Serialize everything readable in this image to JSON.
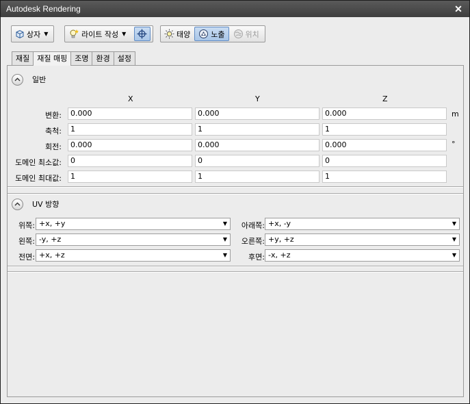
{
  "window": {
    "title": "Autodesk Rendering",
    "close_glyph": "✕"
  },
  "toolbar": {
    "box_label": "상자",
    "light_label": "라이트 작성",
    "sun_label": "태양",
    "exposure_label": "노출",
    "location_label": "위치"
  },
  "tabs": [
    {
      "label": "재질"
    },
    {
      "label": "재질 매핑"
    },
    {
      "label": "조명"
    },
    {
      "label": "환경"
    },
    {
      "label": "설정"
    }
  ],
  "general": {
    "title": "일반",
    "columns": [
      "X",
      "Y",
      "Z"
    ],
    "rows": [
      {
        "label": "변환:",
        "values": [
          "0.000",
          "0.000",
          "0.000"
        ],
        "unit": "m"
      },
      {
        "label": "축척:",
        "values": [
          "1",
          "1",
          "1"
        ],
        "unit": ""
      },
      {
        "label": "회전:",
        "values": [
          "0.000",
          "0.000",
          "0.000"
        ],
        "unit": "°"
      },
      {
        "label": "도메인 최소값:",
        "values": [
          "0",
          "0",
          "0"
        ],
        "unit": ""
      },
      {
        "label": "도메인 최대값:",
        "values": [
          "1",
          "1",
          "1"
        ],
        "unit": ""
      }
    ]
  },
  "uv": {
    "title": "UV 방향",
    "fields": [
      {
        "label": "위쪽:",
        "value": "+x, +y"
      },
      {
        "label": "아래쪽:",
        "value": "+x, -y"
      },
      {
        "label": "왼쪽:",
        "value": "-y, +z"
      },
      {
        "label": "오른쪽:",
        "value": "+y, +z"
      },
      {
        "label": "전면:",
        "value": "+x, +z"
      },
      {
        "label": "후면:",
        "value": "-x, +z"
      }
    ]
  },
  "glyphs": {
    "collapse": "⌃",
    "dropdown_arrow": "▼"
  },
  "colors": {
    "active_blue": "#a9c6e8",
    "titlebar": "#4a4a4a"
  }
}
